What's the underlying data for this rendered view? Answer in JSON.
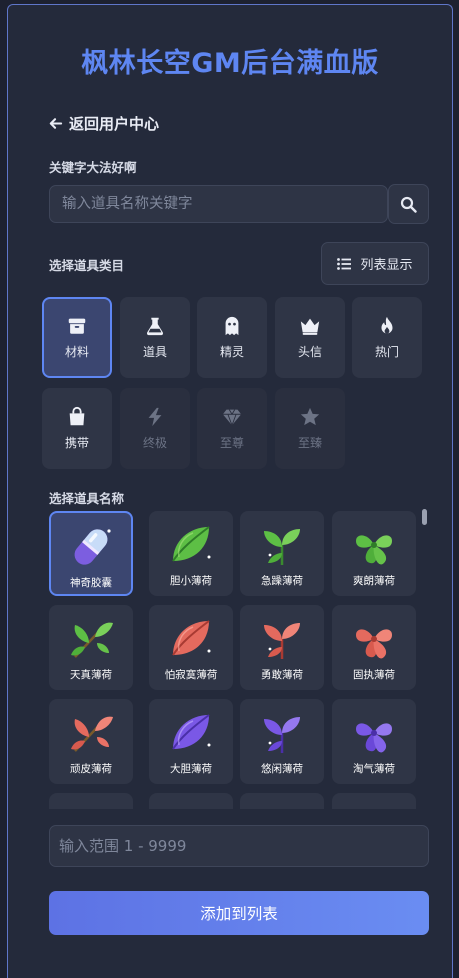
{
  "app": {
    "title": "枫林长空GM后台满血版"
  },
  "nav": {
    "back_label": "返回用户中心"
  },
  "search": {
    "label": "关键字大法好啊",
    "placeholder": "输入道具名称关键字"
  },
  "category": {
    "label": "选择道具类目",
    "view_toggle": "列表显示",
    "items": [
      {
        "label": "材料",
        "icon": "box-icon",
        "state": "selected"
      },
      {
        "label": "道具",
        "icon": "flask-icon",
        "state": "normal"
      },
      {
        "label": "精灵",
        "icon": "ghost-icon",
        "state": "normal"
      },
      {
        "label": "头信",
        "icon": "crown-icon",
        "state": "normal"
      },
      {
        "label": "热门",
        "icon": "fire-icon",
        "state": "normal"
      },
      {
        "label": "携带",
        "icon": "bag-icon",
        "state": "normal"
      },
      {
        "label": "终极",
        "icon": "bolt-icon",
        "state": "disabled"
      },
      {
        "label": "至尊",
        "icon": "gem-icon",
        "state": "disabled"
      },
      {
        "label": "至臻",
        "icon": "star-icon",
        "state": "disabled"
      }
    ]
  },
  "items_section": {
    "label": "选择道具名称",
    "items": [
      {
        "name": "神奇胶囊",
        "icon": "capsule-icon",
        "selected": true
      },
      {
        "name": "胆小薄荷",
        "icon": "leaf-green-icon"
      },
      {
        "name": "急躁薄荷",
        "icon": "sprout-green-icon"
      },
      {
        "name": "爽朗薄荷",
        "icon": "clover-green-icon"
      },
      {
        "name": "天真薄荷",
        "icon": "sprig-green-icon"
      },
      {
        "name": "怕寂寞薄荷",
        "icon": "leaf-red-icon"
      },
      {
        "name": "勇敢薄荷",
        "icon": "sprout-red-icon"
      },
      {
        "name": "固执薄荷",
        "icon": "clover-red-icon"
      },
      {
        "name": "顽皮薄荷",
        "icon": "sprig-red-icon"
      },
      {
        "name": "大胆薄荷",
        "icon": "leaf-purple-icon"
      },
      {
        "name": "悠闲薄荷",
        "icon": "sprout-purple-icon"
      },
      {
        "name": "淘气薄荷",
        "icon": "clover-purple-icon"
      }
    ]
  },
  "range_input": {
    "placeholder": "输入范围 1 - 9999"
  },
  "submit": {
    "label": "添加到列表"
  },
  "colors": {
    "accent": "#5e86f2",
    "background": "#242a3b",
    "card": "#2f3546"
  }
}
